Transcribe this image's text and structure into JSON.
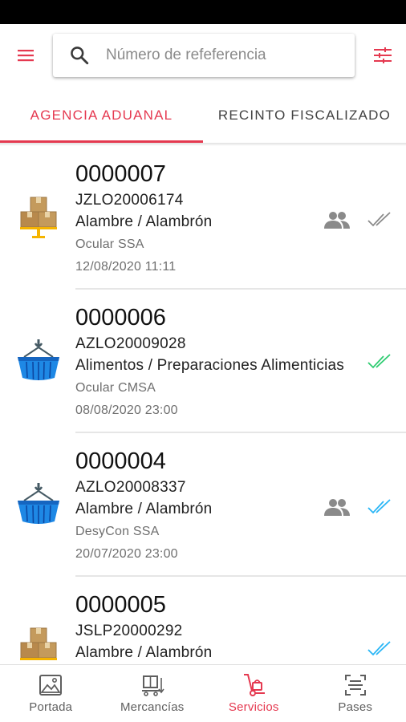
{
  "header": {
    "menu_icon": "hamburger-menu-icon",
    "search": {
      "icon": "search-icon",
      "value": "",
      "placeholder": "Número de refeferencia"
    },
    "filter_icon": "tune-sliders-icon"
  },
  "tabs": [
    {
      "label": "AGENCIA ADUANAL",
      "active": true
    },
    {
      "label": "RECINTO FISCALIZADO",
      "active": false
    }
  ],
  "items": [
    {
      "number": "0000007",
      "reference": "JZLO20006174",
      "goods": "Alambre / Alambrón",
      "inspection": "Ocular SSA",
      "datetime": "12/08/2020 11:11",
      "icon": "boxes-icon",
      "people": true,
      "check_color": "#8a8a8a"
    },
    {
      "number": "0000006",
      "reference": "AZLO20009028",
      "goods": "Alimentos / Preparaciones Alimenticias",
      "inspection": "Ocular CMSA",
      "datetime": "08/08/2020 23:00",
      "icon": "crane-container-icon",
      "people": false,
      "check_color": "#2ecc71"
    },
    {
      "number": "0000004",
      "reference": "AZLO20008337",
      "goods": "Alambre / Alambrón",
      "inspection": "DesyCon SSA",
      "datetime": "20/07/2020 23:00",
      "icon": "crane-container-icon",
      "people": true,
      "check_color": "#29b6f6"
    },
    {
      "number": "0000005",
      "reference": "JSLP20000292",
      "goods": "Alambre / Alambrón",
      "inspection": "",
      "datetime": "",
      "icon": "boxes-icon",
      "people": false,
      "check_color": "#29b6f6"
    }
  ],
  "bottom_nav": [
    {
      "label": "Portada",
      "icon": "image-icon",
      "active": false
    },
    {
      "label": "Mercancías",
      "icon": "cargo-icon",
      "active": false
    },
    {
      "label": "Servicios",
      "icon": "hand-truck-icon",
      "active": true
    },
    {
      "label": "Pases",
      "icon": "scan-pass-icon",
      "active": false
    }
  ],
  "colors": {
    "accent": "#e53950",
    "container_blue": "#1e88e5",
    "box_tan": "#c49a5c",
    "check_grey": "#8a8a8a",
    "check_green": "#2ecc71",
    "check_blue": "#29b6f6"
  }
}
